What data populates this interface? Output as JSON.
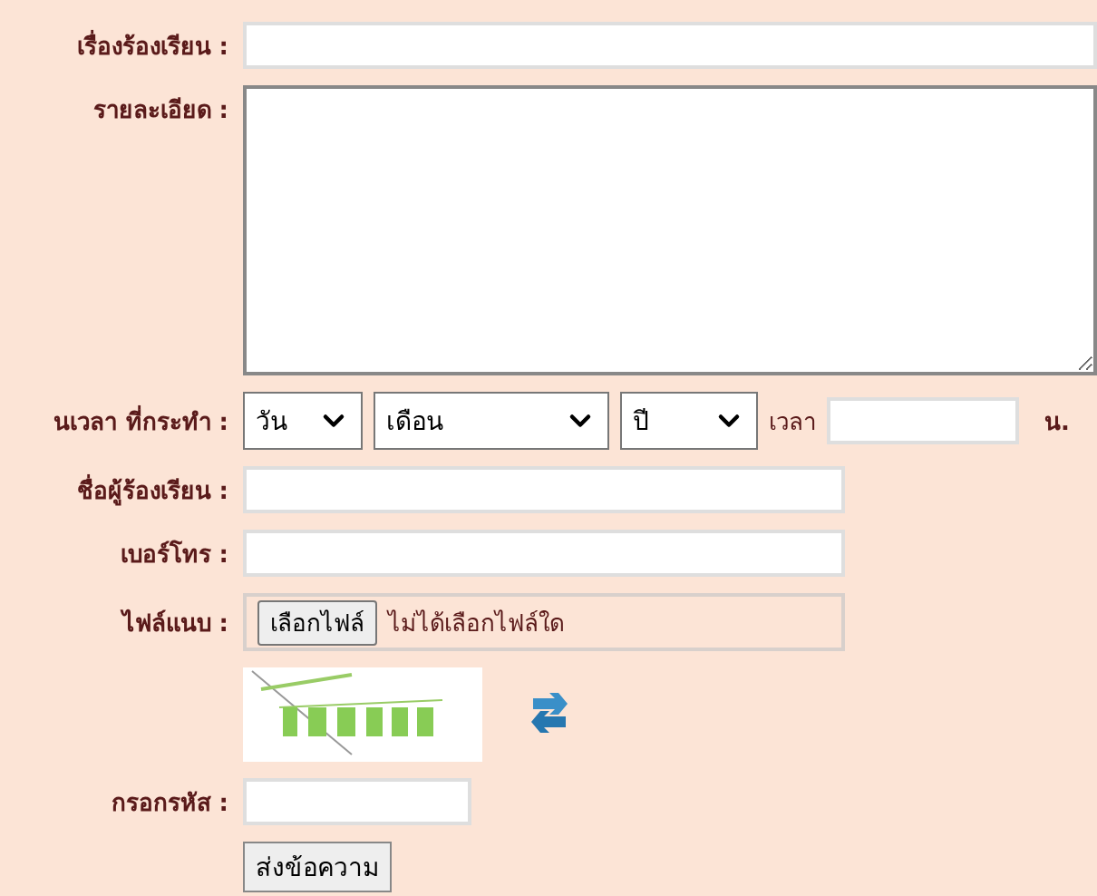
{
  "fields": [
    {
      "kind": "wide",
      "label": "เรื่องร้องเรียน :"
    },
    {
      "kind": "textarea",
      "label": "รายละเอียด :"
    },
    {
      "kind": "datetime",
      "label": "นเวลา ที่กระทำ :",
      "selects": [
        "วัน",
        "เดือน",
        "ปี"
      ],
      "time_label": "เวลา",
      "time_unit": "น."
    },
    {
      "kind": "text",
      "label": "ชื่อผู้ร้องเรียน :"
    },
    {
      "kind": "text",
      "label": "เบอร์โทร :"
    },
    {
      "kind": "file",
      "label": "ไฟล์แนบ :",
      "button": "เลือกไฟล์",
      "status": "ไม่ได้เลือกไฟล์ใด"
    },
    {
      "kind": "captcha"
    },
    {
      "kind": "code",
      "label": "กรอกรหัส :"
    }
  ],
  "submit": "ส่งข้อความ"
}
